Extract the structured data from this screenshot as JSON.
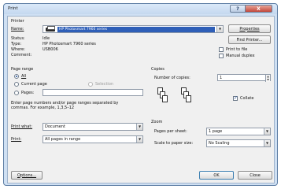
{
  "window": {
    "title": "Print"
  },
  "printer": {
    "group": "Printer",
    "name_label": "Name:",
    "name_value": "HP Photosmart 7960 series",
    "properties": "Properties",
    "find": "Find Printer...",
    "status_label": "Status:",
    "status_value": "Idle",
    "type_label": "Type:",
    "type_value": "HP Photosmart 7960 series",
    "where_label": "Where:",
    "where_value": "USB006",
    "comment_label": "Comment:",
    "print_to_file": "Print to file",
    "manual_duplex": "Manual duplex"
  },
  "page_range": {
    "group": "Page range",
    "all": "All",
    "current": "Current page",
    "selection": "Selection",
    "pages": "Pages:",
    "hint": "Enter page numbers and/or page ranges separated by commas. For example, 1,3,5–12"
  },
  "copies": {
    "group": "Copies",
    "number_label": "Number of copies:",
    "number_value": "1",
    "collate": "Collate"
  },
  "print_what": {
    "label": "Print what:",
    "value": "Document"
  },
  "print_sel": {
    "label": "Print:",
    "value": "All pages in range"
  },
  "zoom": {
    "group": "Zoom",
    "pps_label": "Pages per sheet:",
    "pps_value": "1 page",
    "scale_label": "Scale to paper size:",
    "scale_value": "No Scaling"
  },
  "footer": {
    "options": "Options...",
    "ok": "OK",
    "close": "Close"
  },
  "icons": {
    "dropdown": "▼",
    "spin_up": "▲",
    "spin_down": "▼",
    "help": "?",
    "close": "X"
  },
  "colors": {
    "selection": "#2f5fb8",
    "frame": "#cfe0f3"
  }
}
